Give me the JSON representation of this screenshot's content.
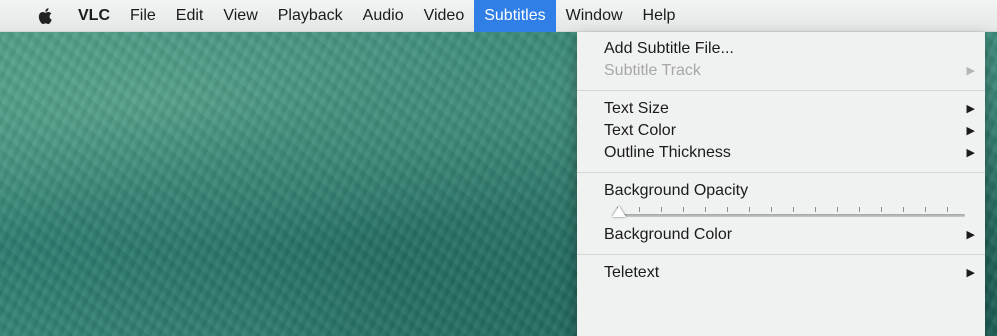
{
  "menubar": {
    "app_name": "VLC",
    "items": [
      "File",
      "Edit",
      "View",
      "Playback",
      "Audio",
      "Video",
      "Subtitles",
      "Window",
      "Help"
    ],
    "active_item": "Subtitles"
  },
  "subtitles_menu": {
    "add_subtitle_file": "Add Subtitle File...",
    "subtitle_track": "Subtitle Track",
    "text_size": "Text Size",
    "text_color": "Text Color",
    "outline_thickness": "Outline Thickness",
    "background_opacity": "Background Opacity",
    "background_opacity_level": 0,
    "background_color": "Background Color",
    "teletext": "Teletext",
    "submenu_arrow": "▶"
  },
  "colors": {
    "menubar_bg": "#e8ebea",
    "menu_highlight": "#2f7fe6",
    "menu_bg": "#f0f2f1",
    "disabled_text": "#a7a7a7"
  }
}
